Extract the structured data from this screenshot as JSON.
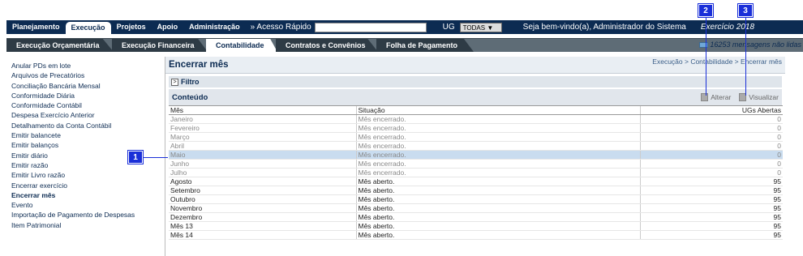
{
  "callouts": [
    "1",
    "2",
    "3"
  ],
  "top_tabs": [
    "Planejamento",
    "Execução",
    "Projetos",
    "Apoio",
    "Administração"
  ],
  "quick_access_label": "» Acesso Rápido",
  "quick_access_value": "",
  "ug_label": "UG",
  "ug_value": "TODAS",
  "welcome": "Seja bem-vindo(a), Administrador do Sistema",
  "exercicio": "Exercício 2018",
  "sub_tabs": [
    "Execução Orçamentária",
    "Execução Financeira",
    "Contabilidade",
    "Contratos e Convênios",
    "Folha de Pagamento"
  ],
  "messages": "16253 mensagens não lidas",
  "sidebar_items": [
    "Anular PDs em lote",
    "Arquivos de Precatórios",
    "Conciliação Bancária Mensal",
    "Conformidade Diária",
    "Conformidade Contábil",
    "Despesa Exercício Anterior",
    "Detalhamento da Conta Contábil",
    "Emitir balancete",
    "Emitir balanços",
    "Emitir diário",
    "Emitir razão",
    "Emitir Livro razão",
    "Encerrar exercício",
    "Encerrar mês",
    "Evento",
    "Importação de Pagamento de Despesas",
    "Item Patrimonial"
  ],
  "page_title": "Encerrar mês",
  "breadcrumb": "Execução > Contabilidade > Encerrar mês",
  "filtro_label": "Filtro",
  "conteudo_label": "Conteúdo",
  "actions": {
    "alterar": "Alterar",
    "visualizar": "Visualizar"
  },
  "table": {
    "headers": [
      "Mês",
      "Situação",
      "UGs Abertas"
    ],
    "rows": [
      {
        "mes": "Janeiro",
        "situacao": "Mês encerrado.",
        "ugs": "0",
        "state": "closed"
      },
      {
        "mes": "Fevereiro",
        "situacao": "Mês encerrado.",
        "ugs": "0",
        "state": "closed"
      },
      {
        "mes": "Março",
        "situacao": "Mês encerrado.",
        "ugs": "0",
        "state": "closed"
      },
      {
        "mes": "Abril",
        "situacao": "Mês encerrado.",
        "ugs": "0",
        "state": "closed"
      },
      {
        "mes": "Maio",
        "situacao": "Mês encerrado.",
        "ugs": "0",
        "state": "selected"
      },
      {
        "mes": "Junho",
        "situacao": "Mês encerrado.",
        "ugs": "0",
        "state": "closed"
      },
      {
        "mes": "Julho",
        "situacao": "Mês encerrado.",
        "ugs": "0",
        "state": "closed"
      },
      {
        "mes": "Agosto",
        "situacao": "Mês aberto.",
        "ugs": "95",
        "state": "open"
      },
      {
        "mes": "Setembro",
        "situacao": "Mês aberto.",
        "ugs": "95",
        "state": "open"
      },
      {
        "mes": "Outubro",
        "situacao": "Mês aberto.",
        "ugs": "95",
        "state": "open"
      },
      {
        "mes": "Novembro",
        "situacao": "Mês aberto.",
        "ugs": "95",
        "state": "open"
      },
      {
        "mes": "Dezembro",
        "situacao": "Mês aberto.",
        "ugs": "95",
        "state": "open"
      },
      {
        "mes": "Mês 13",
        "situacao": "Mês aberto.",
        "ugs": "95",
        "state": "open"
      },
      {
        "mes": "Mês 14",
        "situacao": "Mês aberto.",
        "ugs": "95",
        "state": "open"
      }
    ]
  }
}
